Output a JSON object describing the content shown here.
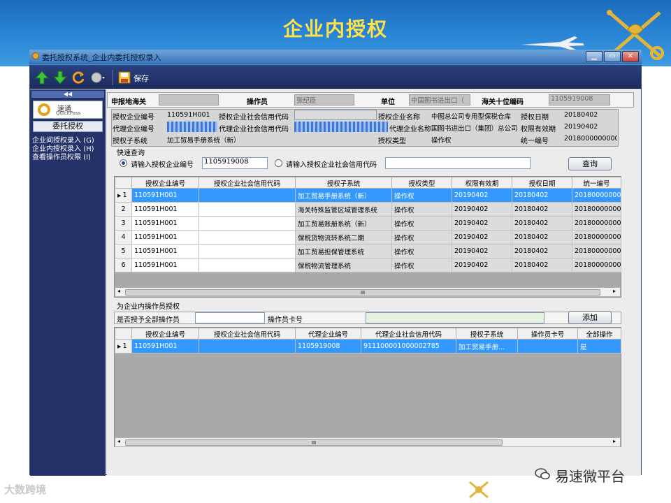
{
  "slide": {
    "title": "企业内授权"
  },
  "window": {
    "title": "委托授权系统_企业内委托授权录入"
  },
  "toolbar": {
    "save_label": "保存"
  },
  "sidebar": {
    "collapse": "◀◀",
    "logo_text": "速通",
    "logo_sub": "QuickPass",
    "section": "委托授权",
    "items": [
      {
        "label": "企业间授权录入 (G)"
      },
      {
        "label": "企业内授权录入 (H)"
      },
      {
        "label": "查看操作员权限 (I)"
      }
    ]
  },
  "header_row": {
    "customs_label": "申报地海关",
    "customs_value": "",
    "operator_label": "操作员",
    "operator_value": "张纪臣",
    "unit_label": "单位",
    "unit_value": "中国图书进出口（",
    "code_label": "海关十位编码",
    "code_value": "1105919008"
  },
  "info": {
    "r1": {
      "l1": "授权企业编号",
      "v1": "110591H001",
      "l2": "授权企业社会信用代码",
      "v2": "",
      "l3": "授权企业名称",
      "v3": "中图总公司专用型保税仓库",
      "l4": "授权日期",
      "v4": "20180402"
    },
    "r2": {
      "l1": "代理企业编号",
      "v1": "",
      "l2": "代理企业社会信用代码",
      "v2": "",
      "l3": "代理企业名称",
      "v3": "国图书进出口（集团）总公司",
      "l4": "权限有效期",
      "v4": "20190402"
    },
    "r3": {
      "l1": "授权子系统",
      "v1": "加工贸易手册系统（新）",
      "l3": "授权类型",
      "v3": "操作权",
      "l4": "统一编号",
      "v4": "20180000000000"
    }
  },
  "quick": {
    "title": "快速查询",
    "opt1": "请输入授权企业编号",
    "val1": "1105919008",
    "opt2": "请输入授权企业社会信用代码",
    "val2": "",
    "btn": "查询"
  },
  "grid1": {
    "columns": [
      "授权企业编号",
      "授权企业社会信用代码",
      "授权子系统",
      "授权类型",
      "权限有效期",
      "授权日期",
      "统一编号"
    ],
    "rows": [
      {
        "n": "1",
        "c": [
          "110591H001",
          "",
          "加工贸易手册系统（新）",
          "操作权",
          "20190402",
          "20180402",
          "201800000000"
        ]
      },
      {
        "n": "2",
        "c": [
          "110591H001",
          "",
          "海关特殊监管区域管理系统",
          "操作权",
          "20190402",
          "20180402",
          "201800000000"
        ]
      },
      {
        "n": "3",
        "c": [
          "110591H001",
          "",
          "加工贸易账册系统（新）",
          "操作权",
          "20190402",
          "20180402",
          "201800000000"
        ]
      },
      {
        "n": "4",
        "c": [
          "110591H001",
          "",
          "保税货物流转系统二期",
          "操作权",
          "20190402",
          "20180402",
          "201800000000"
        ]
      },
      {
        "n": "5",
        "c": [
          "110591H001",
          "",
          "加工贸易担保管理系统",
          "操作权",
          "20190402",
          "20180402",
          "201800000000"
        ]
      },
      {
        "n": "6",
        "c": [
          "110591H001",
          "",
          "保税物流管理系统",
          "操作权",
          "20190402",
          "20180402",
          "201800000000"
        ]
      }
    ],
    "scroll_mark": "III"
  },
  "assign": {
    "title": "为企业内操作员授权",
    "all_label": "是否授予全部操作员",
    "all_value": "",
    "card_label": "操作员卡号",
    "card_value": "",
    "add_btn": "添加"
  },
  "grid2": {
    "columns": [
      "授权企业编号",
      "授权企业社会信用代码",
      "代理企业编号",
      "代理企业社会信用代码",
      "授权子系统",
      "操作员卡号",
      "全部操作"
    ],
    "rows": [
      {
        "n": "1",
        "c": [
          "110591H001",
          "",
          "1105919008",
          "911100001000002785",
          "加工贸易手册…",
          "",
          "是"
        ]
      }
    ],
    "scroll_mark": "III"
  },
  "watermarks": {
    "left": "大数跨境",
    "right": "易速微平台"
  },
  "colors": {
    "header_blue": "#2a86d6",
    "title_yellow": "#ffe24a",
    "toolbar_navy": "#1b2c5e",
    "selection_blue": "#3399ff"
  }
}
